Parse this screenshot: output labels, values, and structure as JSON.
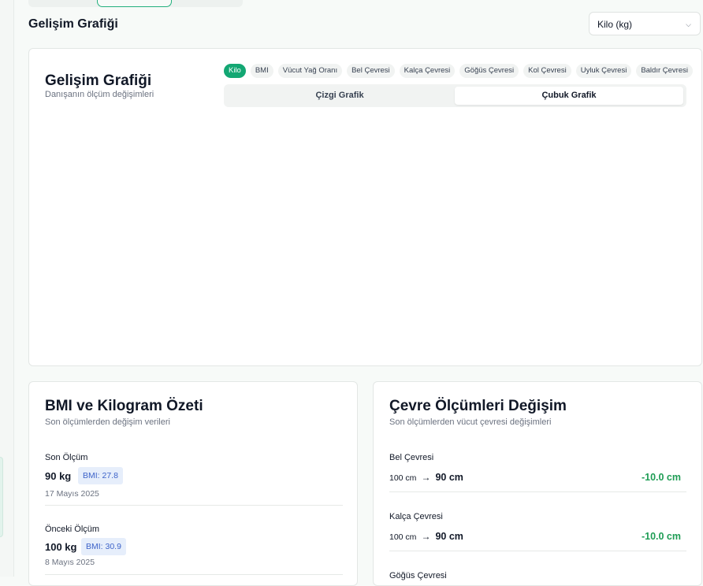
{
  "header": {
    "title": "Gelişim Grafiği",
    "metric_select": {
      "value": "Kilo (kg)"
    }
  },
  "chart_card": {
    "title": "Gelişim Grafiği",
    "subtitle": "Danışanın ölçüm değişimleri",
    "metric_pills": [
      "Kilo",
      "BMI",
      "Vücut Yağ Oranı",
      "Bel Çevresi",
      "Kalça Çevresi",
      "Göğüs Çevresi",
      "Kol Çevresi",
      "Uyluk Çevresi",
      "Baldır Çevresi"
    ],
    "active_pill": "Kilo",
    "chart_type_tabs": [
      "Çizgi Grafik",
      "Çubuk Grafik"
    ],
    "active_chart_type": "Çubuk Grafik"
  },
  "bmi_card": {
    "title": "BMI ve Kilogram Özeti",
    "subtitle": "Son ölçümlerden değişim verileri",
    "latest": {
      "label": "Son Ölçüm",
      "weight": "90 kg",
      "bmi": "BMI: 27.8",
      "date": "17 Mayıs 2025"
    },
    "previous": {
      "label": "Önceki Ölçüm",
      "weight": "100 kg",
      "bmi": "BMI: 30.9",
      "date": "8 Mayıs 2025"
    }
  },
  "circ_card": {
    "title": "Çevre Ölçümleri Değişim",
    "subtitle": "Son ölçümlerden vücut çevresi değişimleri",
    "items": [
      {
        "label": "Bel Çevresi",
        "from": "100 cm",
        "arrow": "→",
        "to": "90 cm",
        "diff": "-10.0 cm"
      },
      {
        "label": "Kalça Çevresi",
        "from": "100 cm",
        "arrow": "→",
        "to": "90 cm",
        "diff": "-10.0 cm"
      },
      {
        "label": "Göğüs Çevresi"
      }
    ]
  },
  "colors": {
    "accent": "#13a773",
    "positive": "#1f9d55",
    "badge_bg": "#e6eefb",
    "badge_text": "#3d63c9"
  }
}
